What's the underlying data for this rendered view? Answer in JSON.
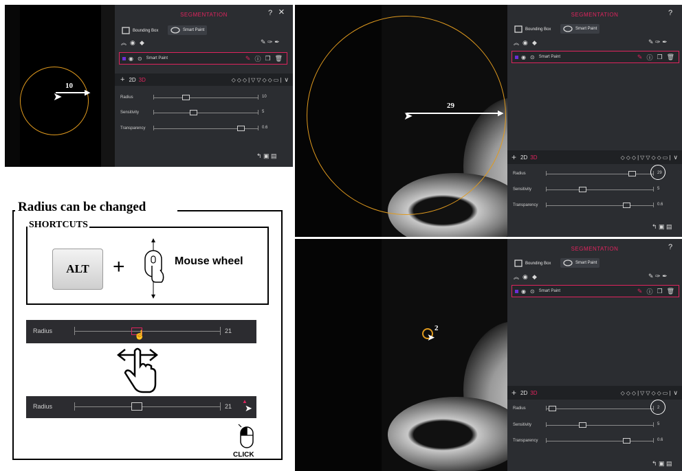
{
  "panel": {
    "title": "SEGMENTATION",
    "bounding_box_label": "Bounding Box",
    "smart_paint_label": "Smart Paint",
    "segment_name": "Smart Paint",
    "mode_2d": "2D",
    "mode_3d": "3D",
    "sliders": {
      "radius_label": "Radius",
      "sensitivity_label": "Sensitivity",
      "transparency_label": "Transparency"
    }
  },
  "shots": {
    "small": {
      "radius_value": "10",
      "sensitivity_value": "5",
      "transparency_value": "0.6",
      "annotation": "10"
    },
    "large": {
      "radius_value": "29",
      "sensitivity_value": "5",
      "transparency_value": "0.6",
      "annotation": "29"
    },
    "tiny": {
      "radius_value": "2",
      "sensitivity_value": "5",
      "transparency_value": "0.6",
      "annotation": "2"
    }
  },
  "guide": {
    "heading": "Radius can be changed",
    "shortcuts_label": "SHORTCUTS",
    "key_label": "ALT",
    "plus": "+",
    "mouse_wheel_label": "Mouse wheel",
    "bar_label_1": "Radius",
    "bar_value_1": "21",
    "bar_label_2": "Radius",
    "bar_value_2": "21",
    "click_label": "CLICK"
  },
  "colors": {
    "accent": "#e0245e",
    "ring": "#e09a1e",
    "panel_bg": "#2b2d31",
    "segment_color": "#6b2fd6"
  }
}
